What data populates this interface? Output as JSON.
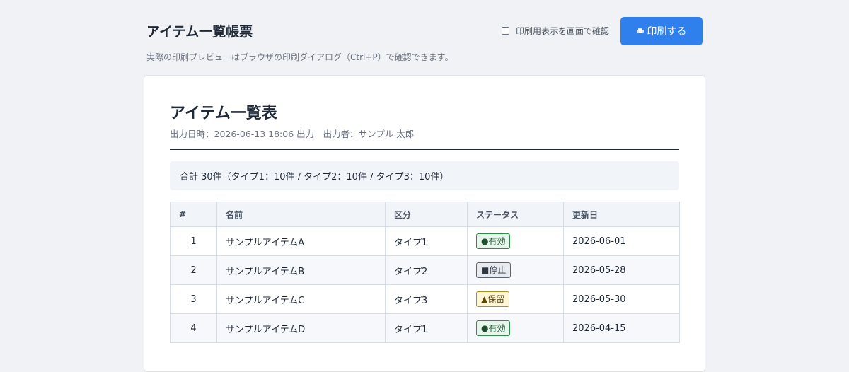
{
  "header": {
    "title": "アイテム一覧帳票",
    "print_view_label": "印刷用表示を画面で確認",
    "print_button_label": "印刷する",
    "print_button_icon": "printer-icon",
    "subtitle": "実際の印刷プレビューはブラウザの印刷ダイアログ（Ctrl+P）で確認できます。"
  },
  "report": {
    "title": "アイテム一覧表",
    "meta": "出力日時：2026-06-13 18:06 出力　出力者：サンプル 太郎",
    "summary": "合計 30件（タイプ1：10件 / タイプ2：10件 / タイプ3：10件）",
    "columns": [
      "#",
      "名前",
      "区分",
      "ステータス",
      "更新日"
    ],
    "rows": [
      {
        "no": "1",
        "name": "サンプルアイテムA",
        "type": "タイプ1",
        "status": "●有効",
        "status_kind": "active",
        "updated": "2026-06-01"
      },
      {
        "no": "2",
        "name": "サンプルアイテムB",
        "type": "タイプ2",
        "status": "■停止",
        "status_kind": "stopped",
        "updated": "2026-05-28"
      },
      {
        "no": "3",
        "name": "サンプルアイテムC",
        "type": "タイプ3",
        "status": "▲保留",
        "status_kind": "hold",
        "updated": "2026-05-30"
      },
      {
        "no": "4",
        "name": "サンプルアイテムD",
        "type": "タイプ1",
        "status": "●有効",
        "status_kind": "active",
        "updated": "2026-04-15"
      }
    ]
  },
  "colors": {
    "accent": "#2f80ed",
    "page_background": "#f0f2f5",
    "status_active": "#2e8b4a",
    "status_stopped": "#5b6573",
    "status_hold": "#b58a16"
  }
}
